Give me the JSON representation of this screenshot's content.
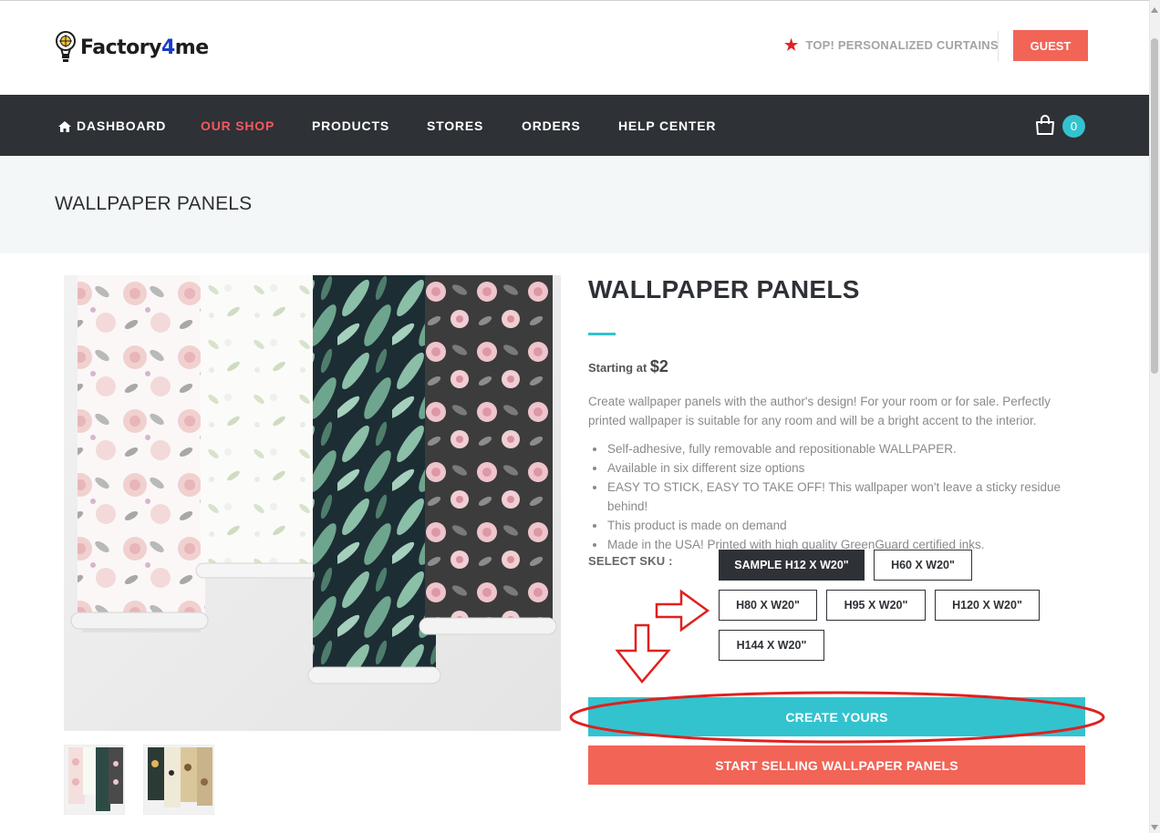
{
  "header": {
    "brand_name": "Factory4me",
    "brand_prefix": "Factory",
    "brand_digit": "4",
    "brand_suffix": "me",
    "promo_text": "TOP! PERSONALIZED CURTAINS",
    "guest_label": "GUEST",
    "colors": {
      "accent_red": "#f26456",
      "star_red": "#e0201e",
      "brand_blue": "#1a3ec6"
    }
  },
  "nav": {
    "items": [
      {
        "label": "DASHBOARD",
        "icon": "home-icon",
        "active": false
      },
      {
        "label": "OUR SHOP",
        "active": true
      },
      {
        "label": "PRODUCTS",
        "active": false
      },
      {
        "label": "STORES",
        "active": false
      },
      {
        "label": "ORDERS",
        "active": false
      },
      {
        "label": "HELP CENTER",
        "active": false
      }
    ],
    "cart_icon": "shopping-bag-icon",
    "cart_count": "0",
    "colors": {
      "background": "#2e3136",
      "active": "#f25a5f",
      "badge": "#33c3cf"
    }
  },
  "page": {
    "band_title": "WALLPAPER PANELS"
  },
  "product": {
    "title": "WALLPAPER PANELS",
    "price_prefix": "Starting at",
    "price_value": "$2",
    "description": "Create wallpaper panels with the author's design! For your room or for sale. Perfectly printed wallpaper is suitable for any room and will be a bright accent to the interior.",
    "features": [
      "Self-adhesive, fully removable and repositionable WALLPAPER.",
      "Available in six different size options",
      "EASY TO STICK, EASY TO TAKE OFF! This wallpaper won't leave a sticky residue behind!",
      "This product is made on demand",
      "Made in the USA! Printed with high quality GreenGuard certified inks."
    ],
    "sku_label": "SELECT SKU :",
    "skus": [
      {
        "label": "SAMPLE H12 X W20\"",
        "selected": true
      },
      {
        "label": "H60 X W20\"",
        "selected": false
      },
      {
        "label": "H80 X W20\"",
        "selected": false
      },
      {
        "label": "H95 X W20\"",
        "selected": false
      },
      {
        "label": "H120 X W20\"",
        "selected": false
      },
      {
        "label": "H144 X W20\"",
        "selected": false
      }
    ],
    "create_label": "CREATE YOURS",
    "sell_label": "START SELLING WALLPAPER PANELS",
    "colors": {
      "create": "#33c3cf",
      "sell": "#f26456",
      "annotation": "#e0201e"
    }
  }
}
